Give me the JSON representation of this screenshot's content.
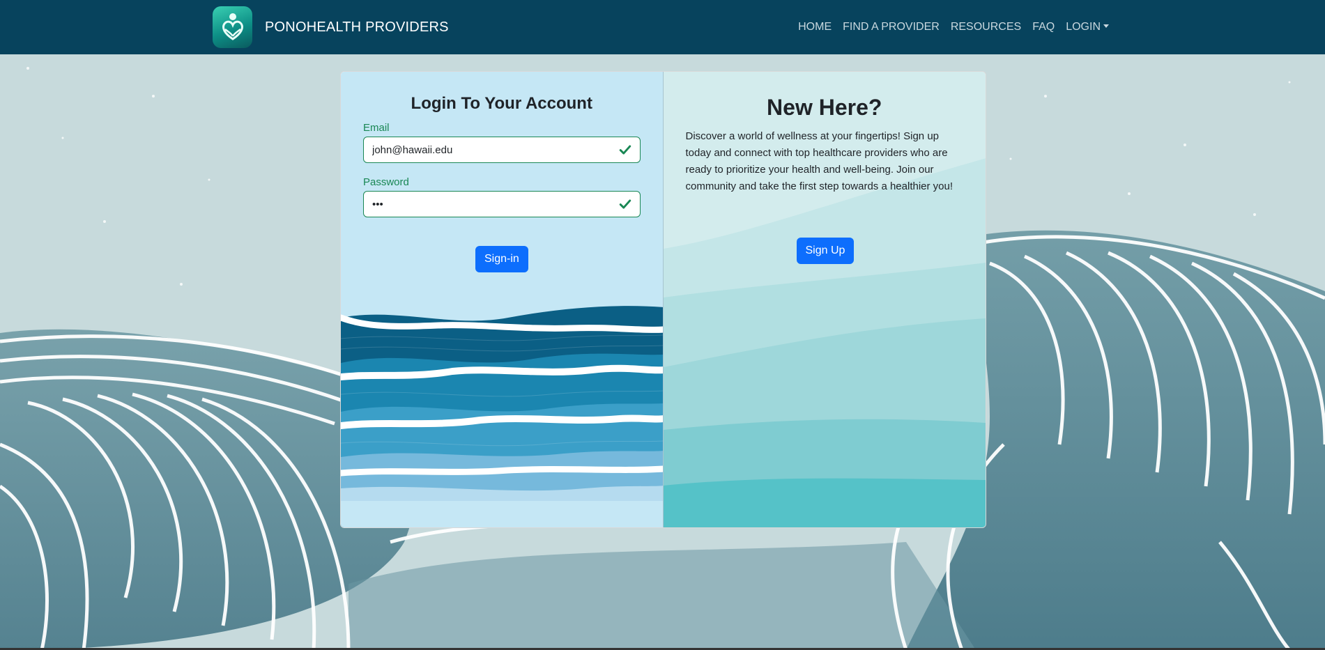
{
  "navbar": {
    "brand_name": "PONOHEALTH PROVIDERS",
    "logo_icon": "hands-heart-logo-icon",
    "links": [
      "HOME",
      "FIND A PROVIDER",
      "RESOURCES",
      "FAQ",
      "LOGIN"
    ],
    "background_color": "#07435d"
  },
  "login_panel": {
    "title": "Login To Your Account",
    "email_label": "Email",
    "email_value": "john@hawaii.edu",
    "password_label": "Password",
    "password_value": "•••",
    "signin_label": "Sign-in",
    "valid_icon": "check-icon"
  },
  "signup_panel": {
    "title": "New Here?",
    "description": "Discover a world of wellness at your fingertips! Sign up today and connect with top healthcare providers who are ready to prioritize your health and well-being. Join our community and take the first step towards a healthier you!",
    "signup_label": "Sign Up"
  },
  "colors": {
    "primary_button": "#0d6efd",
    "valid_green": "#198754",
    "wave_dark": "#0b5f85",
    "teal_light": "#8fd4d6"
  }
}
